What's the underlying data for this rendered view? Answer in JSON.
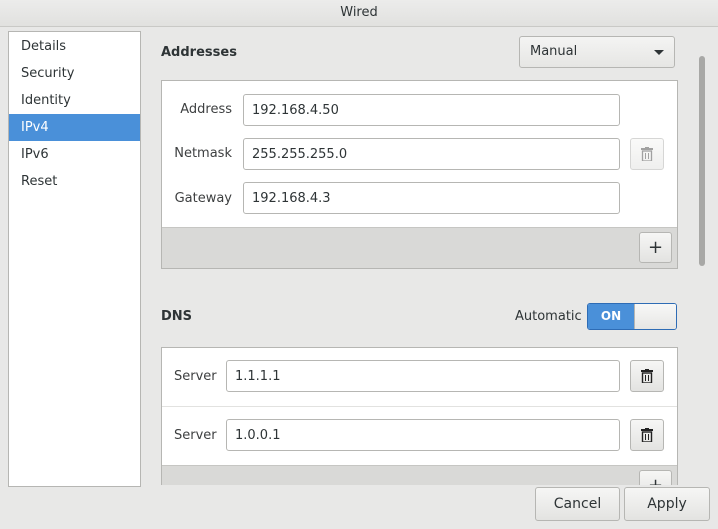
{
  "window": {
    "title": "Wired"
  },
  "sidebar": {
    "items": [
      {
        "label": "Details"
      },
      {
        "label": "Security"
      },
      {
        "label": "Identity"
      },
      {
        "label": "IPv4"
      },
      {
        "label": "IPv6"
      },
      {
        "label": "Reset"
      }
    ],
    "selected": "IPv4"
  },
  "addresses": {
    "title": "Addresses",
    "method": "Manual",
    "address_label": "Address",
    "address_value": "192.168.4.50",
    "netmask_label": "Netmask",
    "netmask_value": "255.255.255.0",
    "gateway_label": "Gateway",
    "gateway_value": "192.168.4.3",
    "add_label": "+"
  },
  "dns": {
    "title": "DNS",
    "automatic_label": "Automatic",
    "toggle_state": "ON",
    "servers": [
      {
        "label": "Server",
        "value": "1.1.1.1"
      },
      {
        "label": "Server",
        "value": "1.0.0.1"
      }
    ],
    "add_label": "+"
  },
  "footer": {
    "cancel_label": "Cancel",
    "apply_label": "Apply"
  },
  "colors": {
    "accent": "#4a90d9",
    "background": "#e8e8e7",
    "footer_strip": "#d9d9d7"
  },
  "icons": [
    "trash-icon",
    "chevron-down-icon",
    "plus-icon"
  ]
}
